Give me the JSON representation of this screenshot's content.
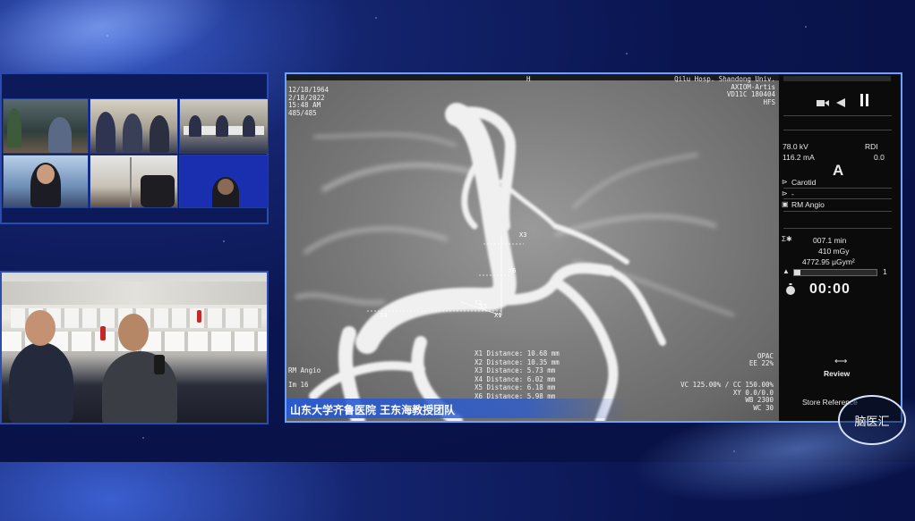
{
  "participants": [
    {
      "caption": "",
      "tile": 1
    },
    {
      "caption": "",
      "tile": 2
    },
    {
      "caption": "",
      "tile": 3
    },
    {
      "caption": "",
      "tile": 4
    },
    {
      "caption": "",
      "tile": 5
    },
    {
      "caption": "",
      "tile": 6
    }
  ],
  "angio": {
    "top_left": "",
    "top_center": "H",
    "top_right": "Qilu Hosp. Shandong Univ.\nAXIOM-Artis\nVD11C 180404\nHFS",
    "left_info": "12/18/1964\n2/18/2022\n15:48 AM\n485/485",
    "bottom_left_1": "RM Angio",
    "bottom_left_2": "Im 16",
    "bottom_right_1": "OPAC",
    "bottom_right_2": "EE 22%",
    "bottom_right_3": "VC 125.00% / CC 150.00%\nXY 0.0/0.0\nWB 2300\nWC 30",
    "markers": [
      "X1",
      "X2",
      "X3",
      "X4",
      "X5",
      "X6"
    ],
    "measurements": [
      "X1 Distance: 10.68 mm",
      "X2 Distance: 10.35 mm",
      "X3 Distance: 5.73 mm",
      "X4 Distance: 6.02 mm",
      "X5 Distance: 6.18 mm",
      "X6 Distance: 5.98 mm"
    ],
    "banner": "山东大学齐鲁医院 王东海教授团队"
  },
  "side": {
    "kv": "78.0 kV",
    "ma": "116.2 mA",
    "rdi_label": "RDI",
    "rdi_value": "0.0",
    "plane": "A",
    "region": "Carotid",
    "sub": "-",
    "program": "RM Angio",
    "fluoro_time": "007.1 min",
    "dose": "410 mGy",
    "dap": "4772.95 µGym²",
    "scale_end": "1",
    "timer": "00:00",
    "review": "Review",
    "store_reference": "Store Reference"
  },
  "logo": {
    "text": "脑医汇"
  },
  "colors": {
    "banner": "#2d5ed2",
    "panel_border": "#6aa2ff",
    "bg": "#0a1550"
  }
}
